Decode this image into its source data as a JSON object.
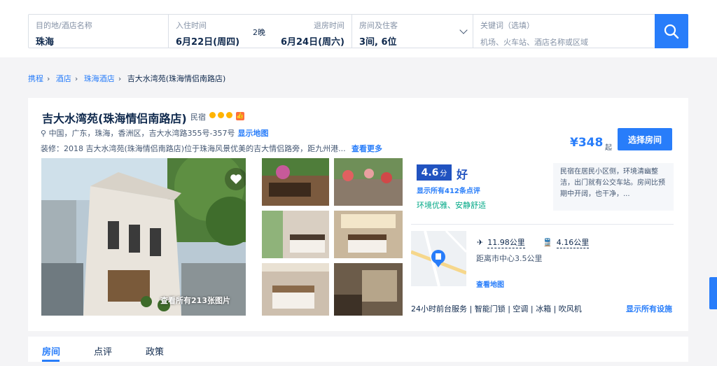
{
  "search": {
    "dest_label": "目的地/酒店名称",
    "dest_value": "珠海",
    "checkin_label": "入住时间",
    "checkin_value": "6月22日(周四)",
    "nights": "2晚",
    "checkout_label": "退房时间",
    "checkout_value": "6月24日(周六)",
    "room_label": "房间及住客",
    "room_value": "3间, 6位",
    "keyword_label": "关键词（选填）",
    "keyword_placeholder": "机场、火车站、酒店名称或区域",
    "search_icon": "search-icon"
  },
  "breadcrumb": [
    "携程",
    "酒店",
    "珠海酒店",
    "吉大水湾苑(珠海情侣南路店)"
  ],
  "hotel": {
    "name": "吉大水湾苑(珠海情侣南路店)",
    "type": "民宿",
    "address": "中国，广东，珠海，香洲区，吉大水湾路355号-357号",
    "show_map": "显示地图",
    "description": "装修：2018   吉大水湾苑(珠海情侣南路店)位于珠海风景优美的吉大情侣路旁，距九州港...",
    "see_more": "查看更多",
    "price": "¥348",
    "price_suffix": "起",
    "select_room": "选择房间",
    "all_photos": "查看所有213张图片",
    "score": "4.6",
    "score_unit": "分",
    "score_word": "好",
    "reviews_link": "显示所有412条点评",
    "tags": "环境优雅、安静舒适",
    "review_quote": "民宿在居民小区侧，环境清幽整洁，出门就有公交车站。房间比预期中开阔，也干净，...",
    "airport_distance": "11.98公里",
    "train_distance": "4.16公里",
    "center_distance": "距离市中心3.5公里",
    "view_map": "查看地图",
    "facilities": "24小时前台服务 | 智能门锁 | 空调 | 冰箱 | 吹风机",
    "all_facilities": "显示所有设施"
  },
  "tabs": [
    "房间",
    "点评",
    "政策"
  ],
  "colors": {
    "accent": "#287dfa",
    "score": "#2153c0",
    "tag": "#00a886",
    "star": "#ffb400"
  }
}
